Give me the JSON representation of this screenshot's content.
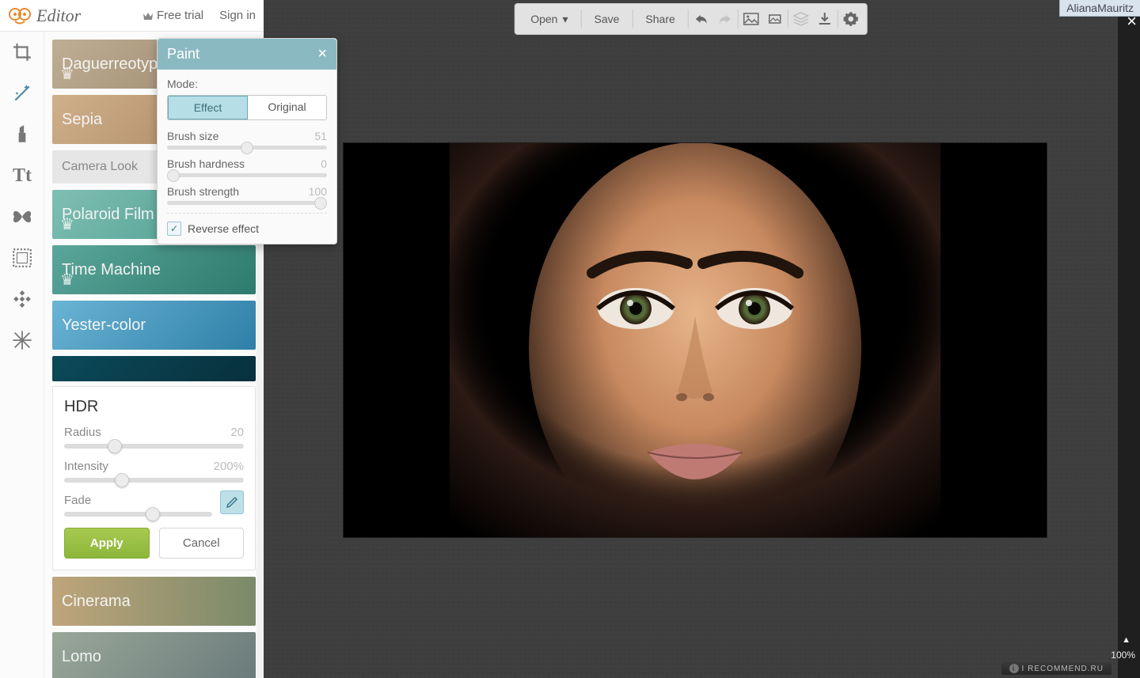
{
  "header": {
    "app_name": "Editor",
    "free_trial": "Free trial",
    "sign_in": "Sign in"
  },
  "top_right": {
    "username": "AlianaMauritz"
  },
  "close_label": "×",
  "zoom": "100%",
  "left_tools": [
    {
      "name": "crop-icon"
    },
    {
      "name": "magic-icon"
    },
    {
      "name": "lipstick-icon"
    },
    {
      "name": "text-icon"
    },
    {
      "name": "butterfly-icon"
    },
    {
      "name": "frame-icon"
    },
    {
      "name": "texture-icon"
    },
    {
      "name": "snowflake-icon"
    }
  ],
  "effects": {
    "tiles": [
      {
        "label": "Daguerreotype",
        "cls": "bg-dag",
        "crown": true
      },
      {
        "label": "Sepia",
        "cls": "bg-sepia",
        "crown": false
      },
      {
        "label": "Camera Look",
        "cls": "light",
        "crown": false
      },
      {
        "label": "Polaroid Film",
        "cls": "bg-polaroid",
        "crown": true
      },
      {
        "label": "Time Machine",
        "cls": "bg-time",
        "crown": true
      },
      {
        "label": "Yester-color",
        "cls": "bg-yester",
        "crown": false
      }
    ],
    "after_tiles": [
      {
        "label": "Cinerama",
        "cls": "bg-cinerama",
        "crown": false
      },
      {
        "label": "Lomo",
        "cls": "bg-lomo",
        "crown": false
      }
    ]
  },
  "hdr": {
    "title": "HDR",
    "radius_label": "Radius",
    "radius_value": "20",
    "radius_pct": "28%",
    "intensity_label": "Intensity",
    "intensity_value": "200%",
    "intensity_pct": "32%",
    "fade_label": "Fade",
    "fade_value": "64%",
    "fade_pct": "60%",
    "apply": "Apply",
    "cancel": "Cancel"
  },
  "paint": {
    "title": "Paint",
    "close": "×",
    "mode_label": "Mode:",
    "mode_effect": "Effect",
    "mode_original": "Original",
    "brush_size_label": "Brush size",
    "brush_size_value": "51",
    "brush_size_pct": "50%",
    "brush_hardness_label": "Brush hardness",
    "brush_hardness_value": "0",
    "brush_hardness_pct": "4%",
    "brush_strength_label": "Brush strength",
    "brush_strength_value": "100",
    "brush_strength_pct": "96%",
    "reverse_label": "Reverse effect",
    "reverse_checked": true
  },
  "toolbar": {
    "open": "Open",
    "save": "Save",
    "share": "Share"
  },
  "watermark": "I RECOMMEND.RU"
}
